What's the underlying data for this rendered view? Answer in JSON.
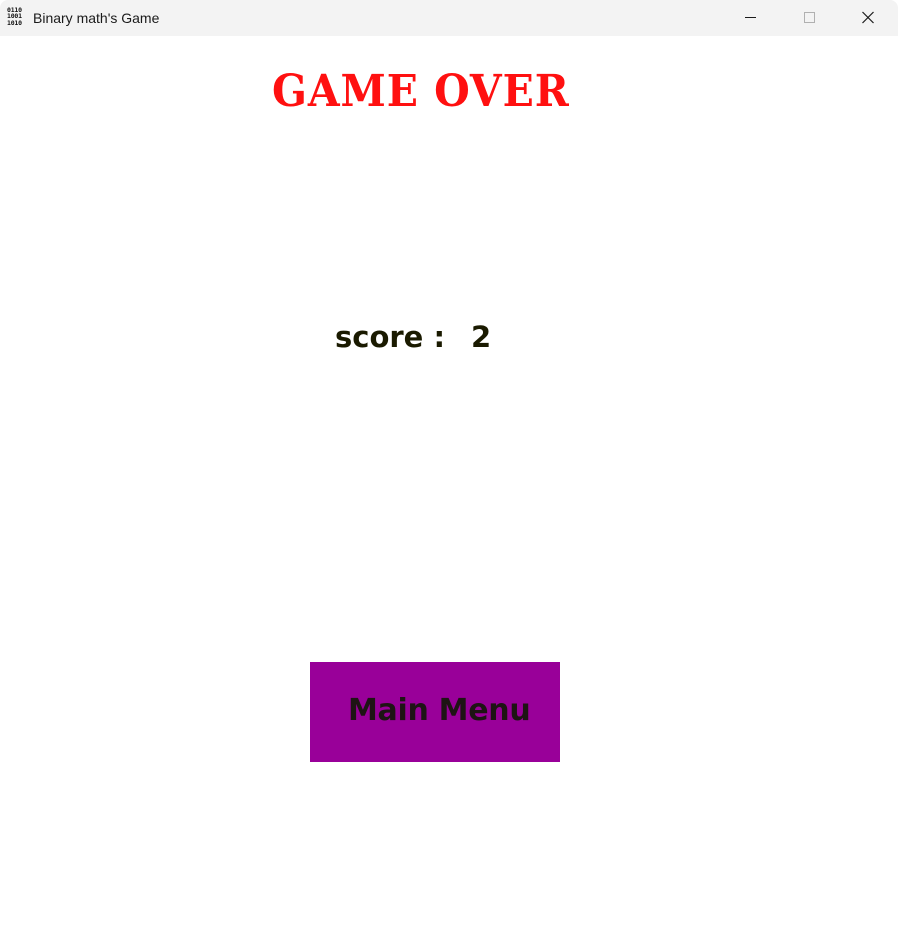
{
  "window": {
    "title": "Binary math's Game",
    "icon_lines": [
      "0110",
      "1001",
      "1010"
    ],
    "icon_name": "binary-app-icon",
    "controls": {
      "minimize_icon": "minimize-icon",
      "maximize_icon": "maximize-icon",
      "close_icon": "close-icon"
    }
  },
  "game": {
    "title": "GAME OVER",
    "score_label": "score :",
    "score_value": "2",
    "main_menu_label": "Main Menu"
  },
  "colors": {
    "title_red": "#ff1010",
    "button_purple": "#990099",
    "text_dark": "#1a1a00",
    "titlebar_bg": "#f3f3f3"
  }
}
